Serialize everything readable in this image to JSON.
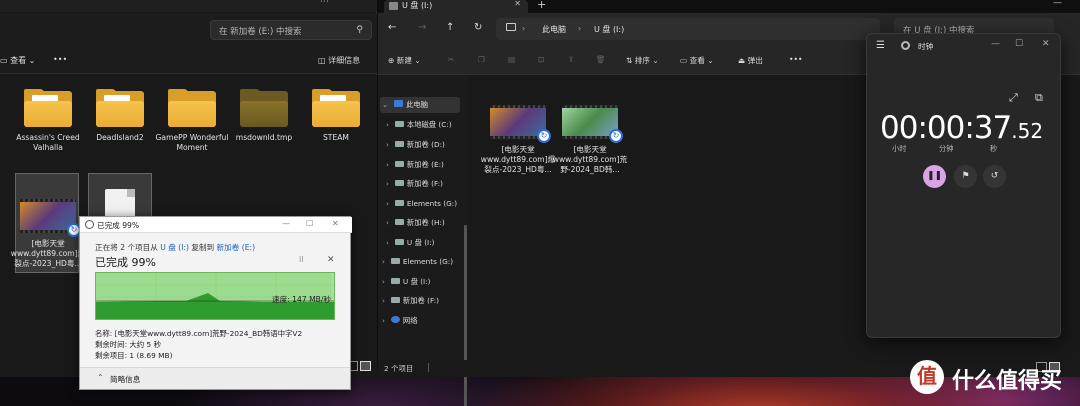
{
  "left_explorer": {
    "search_placeholder": "在 新加卷 (E:) 中搜索",
    "toolbar": {
      "view_label": "查看",
      "more_label": "•••",
      "details_label": "详细信息"
    },
    "items": [
      {
        "name": "Assassin's Creed Valhalla",
        "kind": "folder"
      },
      {
        "name": "DeadIsland2",
        "kind": "folder"
      },
      {
        "name": "GamePP Wonderful Moment",
        "kind": "folder"
      },
      {
        "name": "msdownld.tmp",
        "kind": "folder-dark"
      },
      {
        "name": "STEAM",
        "kind": "folder"
      },
      {
        "name": "[电影天堂www.dytt89.com]爆裂点-2023_HD粤...",
        "kind": "video"
      },
      {
        "name": "",
        "kind": "document"
      }
    ]
  },
  "copy_dialog": {
    "title": "已完成 99%",
    "line_prefix": "正在将 2 个项目从",
    "source": "U 盘 (I:)",
    "line_middle": "复制到",
    "destination": "新加卷 (E:)",
    "progress_heading": "已完成 99%",
    "progress_percent": 99,
    "speed": "速度: 147 MB/秒",
    "name_line": "名称: [电影天堂www.dytt89.com]荒野-2024_BD韩语中字V2",
    "time_left": "剩余时间: 大约 5 秒",
    "items_left": "剩余项目: 1 (8.69 MB)",
    "less_details": "简略信息",
    "pause_icon": "pause-icon",
    "close_icon": "close-icon"
  },
  "right_explorer": {
    "tab_label": "U 盘 (I:)",
    "breadcrumb": [
      "此电脑",
      "U 盘 (I:)"
    ],
    "search_placeholder": "在 U 盘 (I:) 中搜索",
    "toolbar": {
      "new_label": "新建",
      "sort_label": "排序",
      "view_label": "查看",
      "eject_label": "弹出",
      "more_label": "•••"
    },
    "nav_items": [
      {
        "label": "此电脑",
        "icon": "pc",
        "expanded": true,
        "selected": true
      },
      {
        "label": "本地磁盘 (C:)",
        "icon": "drive"
      },
      {
        "label": "新加卷 (D:)",
        "icon": "drive"
      },
      {
        "label": "新加卷 (E:)",
        "icon": "drive"
      },
      {
        "label": "新加卷 (F:)",
        "icon": "drive"
      },
      {
        "label": "Elements (G:)",
        "icon": "drive"
      },
      {
        "label": "新加卷 (H:)",
        "icon": "drive"
      },
      {
        "label": "U 盘 (I:)",
        "icon": "drive"
      },
      {
        "label": "Elements (G:)",
        "icon": "drive"
      },
      {
        "label": "U 盘 (I:)",
        "icon": "drive"
      },
      {
        "label": "新加卷 (F:)",
        "icon": "drive"
      },
      {
        "label": "网络",
        "icon": "network"
      }
    ],
    "files": [
      {
        "name": "[电影天堂www.dytt89.com]爆裂点-2023_HD粤...",
        "thumb": "orange"
      },
      {
        "name": "[电影天堂www.dytt89.com]荒野-2024_BD韩...",
        "thumb": "green"
      }
    ],
    "status": "2 个项目"
  },
  "clock_app": {
    "title": "时钟",
    "time_main": "00:00:37",
    "time_fraction": ".52",
    "unit_hours": "小时",
    "unit_minutes": "分钟",
    "unit_seconds": "秒",
    "accent_color": "#d9a3e6"
  },
  "watermark": {
    "symbol": "值",
    "text": "什么值得买"
  }
}
